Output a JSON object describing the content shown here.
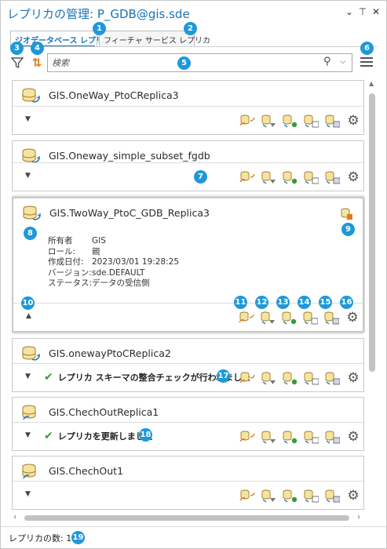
{
  "window": {
    "title": "レプリカの管理: P_GDB@gis.sde",
    "controls": [
      "⌄",
      "⊤",
      "✕"
    ]
  },
  "tabs": [
    {
      "label": "ジオデータベース レプリカ",
      "active": true
    },
    {
      "label": "フィーチャ サービス レプリカ",
      "active": false
    }
  ],
  "search": {
    "placeholder": "検索",
    "value": ""
  },
  "replicas": [
    {
      "name": "GIS.OneWay_PtoCReplica3",
      "status": ""
    },
    {
      "name": "GIS.Oneway_simple_subset_fgdb",
      "status": ""
    },
    {
      "name": "GIS.TwoWay_PtoC_GDB_Replica3",
      "status": "",
      "details": [
        {
          "label": "所有者",
          "value": "GIS"
        },
        {
          "label": "ロール:",
          "value": "親"
        },
        {
          "label": "作成日付:",
          "value": "2023/03/01 19:28:25"
        },
        {
          "label": "バージョン:",
          "value": "sde.DEFAULT"
        },
        {
          "label": "ステータス:",
          "value": "データの受信側"
        }
      ]
    },
    {
      "name": "GIS.onewayPtoCReplica2",
      "status": "レプリカ スキーマの整合チェックが行われました"
    },
    {
      "name": "GIS.ChechOutReplica1",
      "status": "レプリカを更新しました"
    },
    {
      "name": "GIS.ChechOut1",
      "status": ""
    }
  ],
  "action_icons": [
    "synchronize-icon",
    "export-acknowledgment-icon",
    "import-message-icon",
    "export-data-changes-icon",
    "re-export-unacknowledged-icon",
    "settings-gear-icon"
  ],
  "statusbar": {
    "count_label": "レプリカの数: 10"
  },
  "callouts": [
    "1",
    "2",
    "3",
    "4",
    "5",
    "6",
    "7",
    "8",
    "9",
    "10",
    "11",
    "12",
    "13",
    "14",
    "15",
    "16",
    "17",
    "18",
    "19"
  ],
  "colors": {
    "accent": "#1a73b8",
    "callout": "#1e98d9",
    "sync_orange": "#e07a1f",
    "ok_green": "#3a9a3a"
  }
}
